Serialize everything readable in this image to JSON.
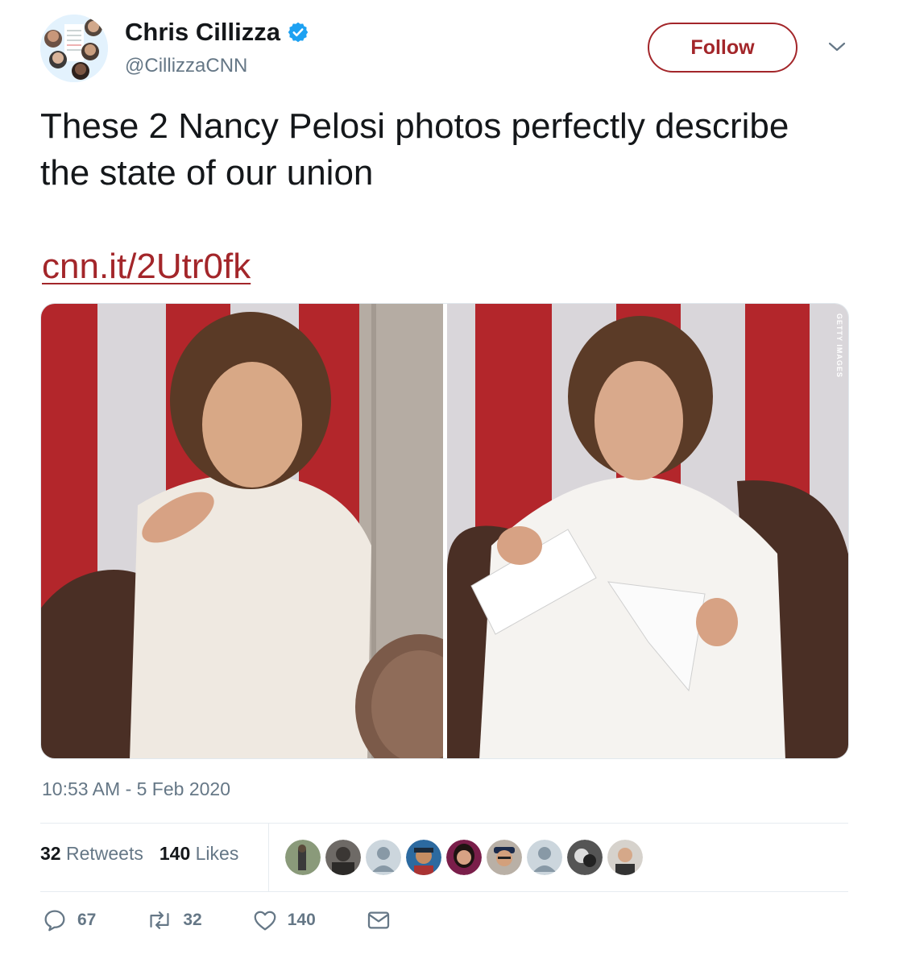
{
  "author": {
    "name": "Chris Cillizza",
    "handle": "@CillizzaCNN",
    "verified": true
  },
  "header": {
    "follow_label": "Follow",
    "menu_icon": "chevron-down-icon"
  },
  "tweet": {
    "text": "These 2 Nancy Pelosi photos perfectly describe the state of our union",
    "link": "cnn.it/2Utr0fk",
    "timestamp": "10:53 AM - 5 Feb 2020"
  },
  "media": {
    "credit": "GETTY IMAGES"
  },
  "stats": {
    "retweets_count": "32",
    "retweets_label": "Retweets",
    "likes_count": "140",
    "likes_label": "Likes"
  },
  "actions": {
    "reply_count": "67",
    "retweet_count": "32",
    "like_count": "140"
  },
  "colors": {
    "accent": "#a3262a",
    "muted": "#657786",
    "verified": "#1da1f2"
  }
}
